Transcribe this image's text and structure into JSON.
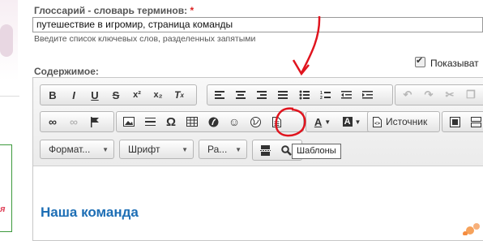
{
  "fields": {
    "glossary_label": "Глоссарий - словарь терминов:",
    "required_mark": "*",
    "glossary_value": "путешествие в игромир, страница команды",
    "glossary_hint": "Введите список ключевых слов, разделенных запятыми",
    "content_label": "Содержимое:",
    "show_label": "Показыват"
  },
  "toolbar": {
    "row1_format": [
      "B",
      "I",
      "U",
      "S",
      "x²",
      "x₂",
      "Tx"
    ],
    "row1_align": [
      "align-left-icon",
      "align-center-icon",
      "align-right-icon",
      "justify-icon",
      "bulleted-list-icon",
      "numbered-list-icon",
      "outdent-icon",
      "indent-icon"
    ],
    "row1_edit": [
      "undo-icon",
      "redo-icon",
      "cut-icon",
      "copy-icon"
    ],
    "row2_links": [
      "link-icon",
      "unlink-icon",
      "anchor-icon"
    ],
    "row2_insert": [
      "image-icon",
      "horizontal-rule-icon",
      "special-char-omega",
      "table-icon",
      "flash-icon",
      "smiley-icon",
      "iframe-icon",
      "templates-icon"
    ],
    "source_label": "Источник",
    "format_combo": "Формат...",
    "font_combo": "Шрифт",
    "size_combo": "Ра...",
    "tooltip": "Шаблоны"
  },
  "content": {
    "heading": "Наша команда"
  },
  "colors": {
    "heading": "#1d6eb5",
    "annotation": "#e0141e",
    "required": "#dd2222"
  }
}
